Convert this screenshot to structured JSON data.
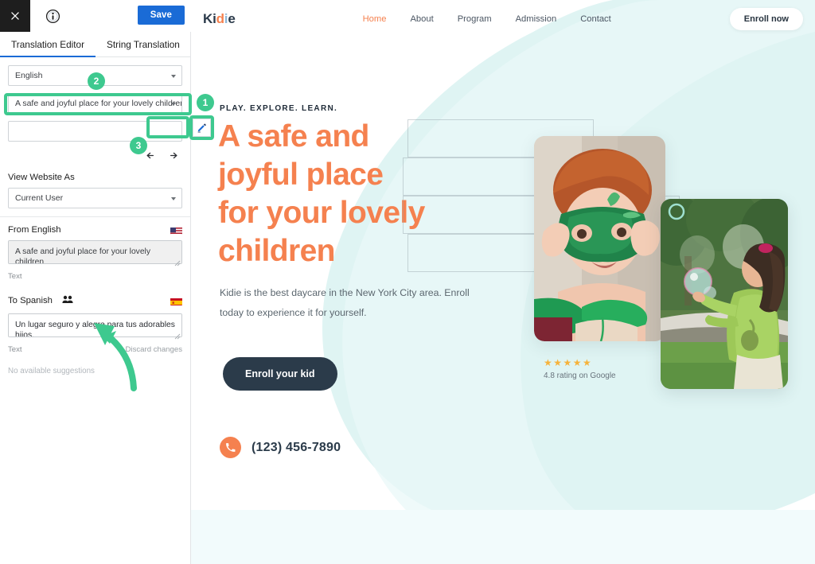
{
  "panel": {
    "close_icon": "close-icon",
    "info_icon": "info-icon",
    "save_label": "Save",
    "tabs": [
      {
        "label": "Translation Editor",
        "active": true
      },
      {
        "label": "String Translation",
        "active": false
      }
    ],
    "language_select": {
      "value": "English",
      "icon": "chevron-down-icon"
    },
    "string_select": {
      "value": "A safe and joyful place for your lovely children",
      "icon": "chevron-down-icon"
    },
    "extra_select": {
      "value": "",
      "icon": "chevron-down-icon"
    },
    "undo_icon": "undo-arrow-icon",
    "redo_icon": "redo-arrow-icon",
    "view_website_as": {
      "label": "View Website As",
      "value": "Current User",
      "icon": "chevron-down-icon"
    },
    "source": {
      "label": "From English",
      "flag": "us-flag-icon",
      "value": "A safe and joyful place for your lovely children",
      "caption": "Text"
    },
    "target": {
      "label": "To Spanish",
      "people_icon": "people-icon",
      "flag": "es-flag-icon",
      "value": "Un lugar seguro y alegre para tus adorables hijos.",
      "caption": "Text",
      "discard_label": "Discard changes",
      "suggestions": "No available suggestions"
    }
  },
  "annotations": {
    "badges": [
      {
        "id": "1",
        "number": "1"
      },
      {
        "id": "2",
        "number": "2"
      },
      {
        "id": "3",
        "number": "3"
      }
    ],
    "pencil_icon": "pencil-edit-icon",
    "arrow_icon": "curved-up-arrow-icon",
    "highlight_color": "#3ec98f"
  },
  "site": {
    "logo": {
      "part1": "Ki",
      "part2": "d",
      "part3": "i",
      "part4": "e"
    },
    "nav": [
      {
        "label": "Home",
        "active": true
      },
      {
        "label": "About",
        "active": false
      },
      {
        "label": "Program",
        "active": false
      },
      {
        "label": "Admission",
        "active": false
      },
      {
        "label": "Contact",
        "active": false
      }
    ],
    "enroll_now": "Enroll now",
    "hero": {
      "eyebrow": "PLAY. EXPLORE. LEARN.",
      "heading_lines": [
        "A safe and",
        "joyful place",
        "for your lovely",
        "children"
      ],
      "lede": "Kidie is the best daycare in the New York City area. Enroll today to experience it for yourself.",
      "cta_label": "Enroll your kid",
      "stars": "★★★★★",
      "rating_text": "4.8 rating on Google",
      "phone_icon": "phone-icon",
      "phone": "(123) 456-7890",
      "photo1_alt": "child-with-green-dinosaur-mask-photo",
      "photo2_alt": "girl-catching-bubbles-photo"
    },
    "colors": {
      "accent_orange": "#f5814f",
      "dark_navy": "#2b3b4a",
      "mint_bg": "#d9f2f0",
      "pale_band": "#f2fbfc",
      "star_gold": "#f6b33c"
    }
  }
}
